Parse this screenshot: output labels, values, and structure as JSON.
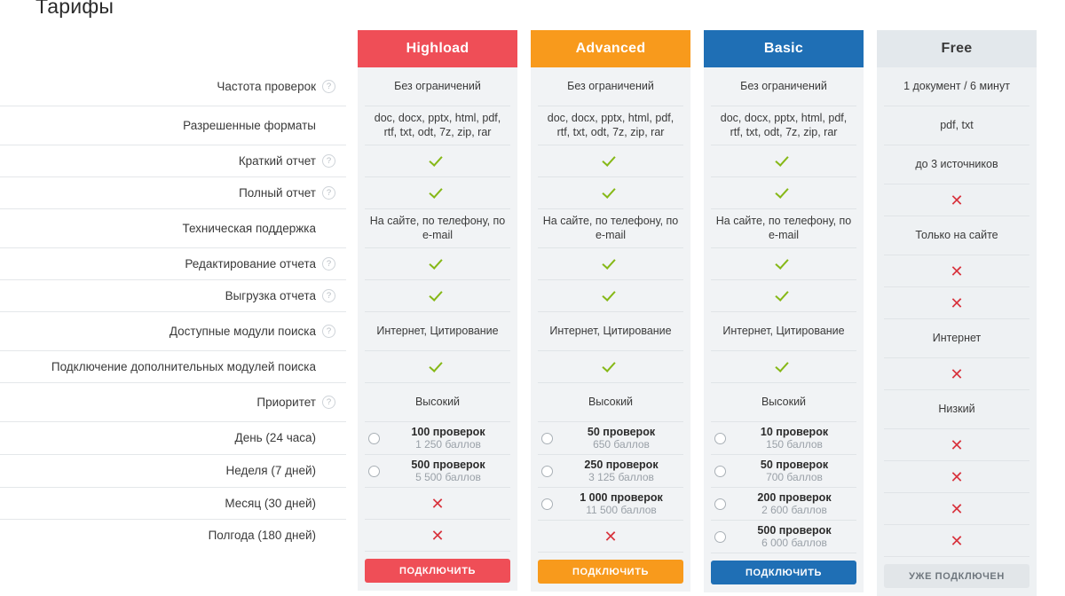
{
  "page": {
    "title": "Тарифы"
  },
  "colors": {
    "highload": "#ef4e57",
    "advanced": "#f89a1c",
    "basic": "#1f6fb5",
    "free_header_bg": "#e3e8ec",
    "check_green": "#86b817",
    "cross_red": "#d8323c"
  },
  "features": [
    {
      "label": "Частота проверок",
      "help": true
    },
    {
      "label": "Разрешенные форматы",
      "help": false
    },
    {
      "label": "Краткий отчет",
      "help": true
    },
    {
      "label": "Полный отчет",
      "help": true
    },
    {
      "label": "Техническая поддержка",
      "help": false
    },
    {
      "label": "Редактирование отчета",
      "help": true
    },
    {
      "label": "Выгрузка отчета",
      "help": true
    },
    {
      "label": "Доступные модули поиска",
      "help": true
    },
    {
      "label": "Подключение дополнительных модулей поиска",
      "help": false
    },
    {
      "label": "Приоритет",
      "help": true
    },
    {
      "label": "День (24 часа)",
      "help": false
    },
    {
      "label": "Неделя (7 дней)",
      "help": false
    },
    {
      "label": "Месяц (30 дней)",
      "help": false
    },
    {
      "label": "Полгода (180 дней)",
      "help": false
    }
  ],
  "help_glyph": "?",
  "plans": [
    {
      "name": "Highload",
      "accent": "#ef4e57",
      "header_text_color": "#ffffff",
      "cells": [
        {
          "type": "text",
          "value": "Без ограничений"
        },
        {
          "type": "text",
          "value": "doc, docx, pptx, html, pdf, rtf, txt, odt, 7z, zip, rar"
        },
        {
          "type": "check"
        },
        {
          "type": "check"
        },
        {
          "type": "text",
          "value": "На сайте, по телефону, по e-mail"
        },
        {
          "type": "check"
        },
        {
          "type": "check"
        },
        {
          "type": "text",
          "value": "Интернет, Цитирование"
        },
        {
          "type": "check"
        },
        {
          "type": "text",
          "value": "Высокий"
        },
        {
          "type": "option",
          "title": "100 проверок",
          "sub": "1 250 баллов"
        },
        {
          "type": "option",
          "title": "500 проверок",
          "sub": "5 500 баллов"
        },
        {
          "type": "cross"
        },
        {
          "type": "cross"
        }
      ],
      "button": {
        "label": "подключить",
        "disabled": false
      }
    },
    {
      "name": "Advanced",
      "accent": "#f89a1c",
      "header_text_color": "#ffffff",
      "cells": [
        {
          "type": "text",
          "value": "Без ограничений"
        },
        {
          "type": "text",
          "value": "doc, docx, pptx, html, pdf, rtf, txt, odt, 7z, zip, rar"
        },
        {
          "type": "check"
        },
        {
          "type": "check"
        },
        {
          "type": "text",
          "value": "На сайте, по телефону, по e-mail"
        },
        {
          "type": "check"
        },
        {
          "type": "check"
        },
        {
          "type": "text",
          "value": "Интернет, Цитирование"
        },
        {
          "type": "check"
        },
        {
          "type": "text",
          "value": "Высокий"
        },
        {
          "type": "option",
          "title": "50 проверок",
          "sub": "650 баллов"
        },
        {
          "type": "option",
          "title": "250 проверок",
          "sub": "3 125 баллов"
        },
        {
          "type": "option",
          "title": "1 000 проверок",
          "sub": "11 500 баллов"
        },
        {
          "type": "cross"
        }
      ],
      "button": {
        "label": "подключить",
        "disabled": false
      }
    },
    {
      "name": "Basic",
      "accent": "#1f6fb5",
      "header_text_color": "#ffffff",
      "cells": [
        {
          "type": "text",
          "value": "Без ограничений"
        },
        {
          "type": "text",
          "value": "doc, docx, pptx, html, pdf, rtf, txt, odt, 7z, zip, rar"
        },
        {
          "type": "check"
        },
        {
          "type": "check"
        },
        {
          "type": "text",
          "value": "На сайте, по телефону, по e-mail"
        },
        {
          "type": "check"
        },
        {
          "type": "check"
        },
        {
          "type": "text",
          "value": "Интернет, Цитирование"
        },
        {
          "type": "check"
        },
        {
          "type": "text",
          "value": "Высокий"
        },
        {
          "type": "option",
          "title": "10 проверок",
          "sub": "150 баллов"
        },
        {
          "type": "option",
          "title": "50 проверок",
          "sub": "700 баллов"
        },
        {
          "type": "option",
          "title": "200 проверок",
          "sub": "2 600 баллов"
        },
        {
          "type": "option",
          "title": "500 проверок",
          "sub": "6 000 баллов"
        }
      ],
      "button": {
        "label": "подключить",
        "disabled": false
      }
    },
    {
      "name": "Free",
      "accent": "#e3e8ec",
      "header_text_color": "#3a3a3a",
      "cells": [
        {
          "type": "text",
          "value": "1 документ / 6 минут"
        },
        {
          "type": "text",
          "value": "pdf, txt"
        },
        {
          "type": "text",
          "value": "до 3 источников"
        },
        {
          "type": "cross"
        },
        {
          "type": "text",
          "value": "Только на сайте"
        },
        {
          "type": "cross"
        },
        {
          "type": "cross"
        },
        {
          "type": "text",
          "value": "Интернет"
        },
        {
          "type": "cross"
        },
        {
          "type": "text",
          "value": "Низкий"
        },
        {
          "type": "cross"
        },
        {
          "type": "cross"
        },
        {
          "type": "cross"
        },
        {
          "type": "cross"
        }
      ],
      "button": {
        "label": "уже подключен",
        "disabled": true
      }
    }
  ]
}
